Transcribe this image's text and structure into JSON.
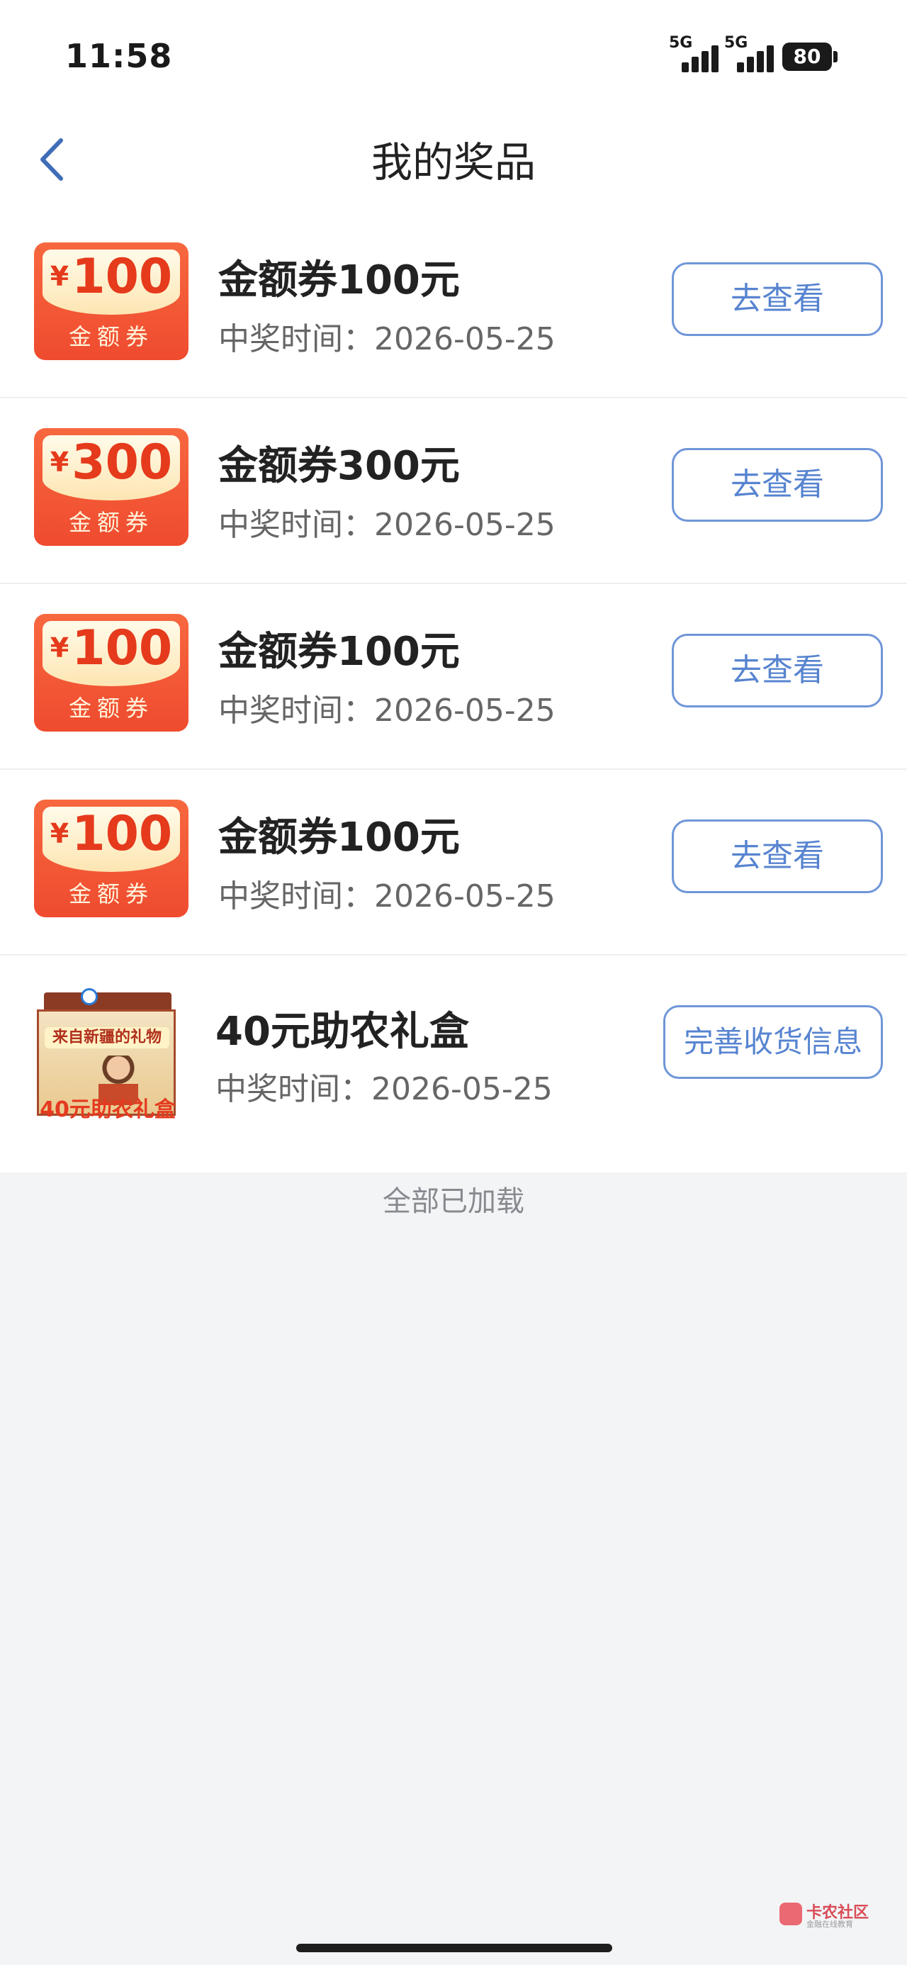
{
  "status_bar": {
    "time": "11:58",
    "network_1": "5G",
    "network_2": "5G",
    "battery": "80"
  },
  "header": {
    "back_icon": "chevron-left-icon",
    "title": "我的奖品"
  },
  "prizes": [
    {
      "type": "coupon",
      "coupon_currency": "¥",
      "coupon_amount": "100",
      "coupon_label": "金额券",
      "name": "金额券100元",
      "win_time": "中奖时间：2026-05-25",
      "action": "去查看"
    },
    {
      "type": "coupon",
      "coupon_currency": "¥",
      "coupon_amount": "300",
      "coupon_label": "金额券",
      "name": "金额券300元",
      "win_time": "中奖时间：2026-05-25",
      "action": "去查看"
    },
    {
      "type": "coupon",
      "coupon_currency": "¥",
      "coupon_amount": "100",
      "coupon_label": "金额券",
      "name": "金额券100元",
      "win_time": "中奖时间：2026-05-25",
      "action": "去查看"
    },
    {
      "type": "coupon",
      "coupon_currency": "¥",
      "coupon_amount": "100",
      "coupon_label": "金额券",
      "name": "金额券100元",
      "win_time": "中奖时间：2026-05-25",
      "action": "去查看"
    },
    {
      "type": "gift",
      "image_title": "来自新疆的礼物",
      "image_caption": "40元助农礼盒",
      "name": "40元助农礼盒",
      "win_time": "中奖时间：2026-05-25",
      "action": "完善收货信息"
    }
  ],
  "footer": {
    "all_loaded": "全部已加载"
  },
  "watermark": {
    "title": "卡农社区",
    "subtitle": "金融在线教育"
  },
  "colors": {
    "accent_blue": "#5784d0",
    "coupon_red": "#ef4b2f",
    "background": "#f3f4f6"
  }
}
